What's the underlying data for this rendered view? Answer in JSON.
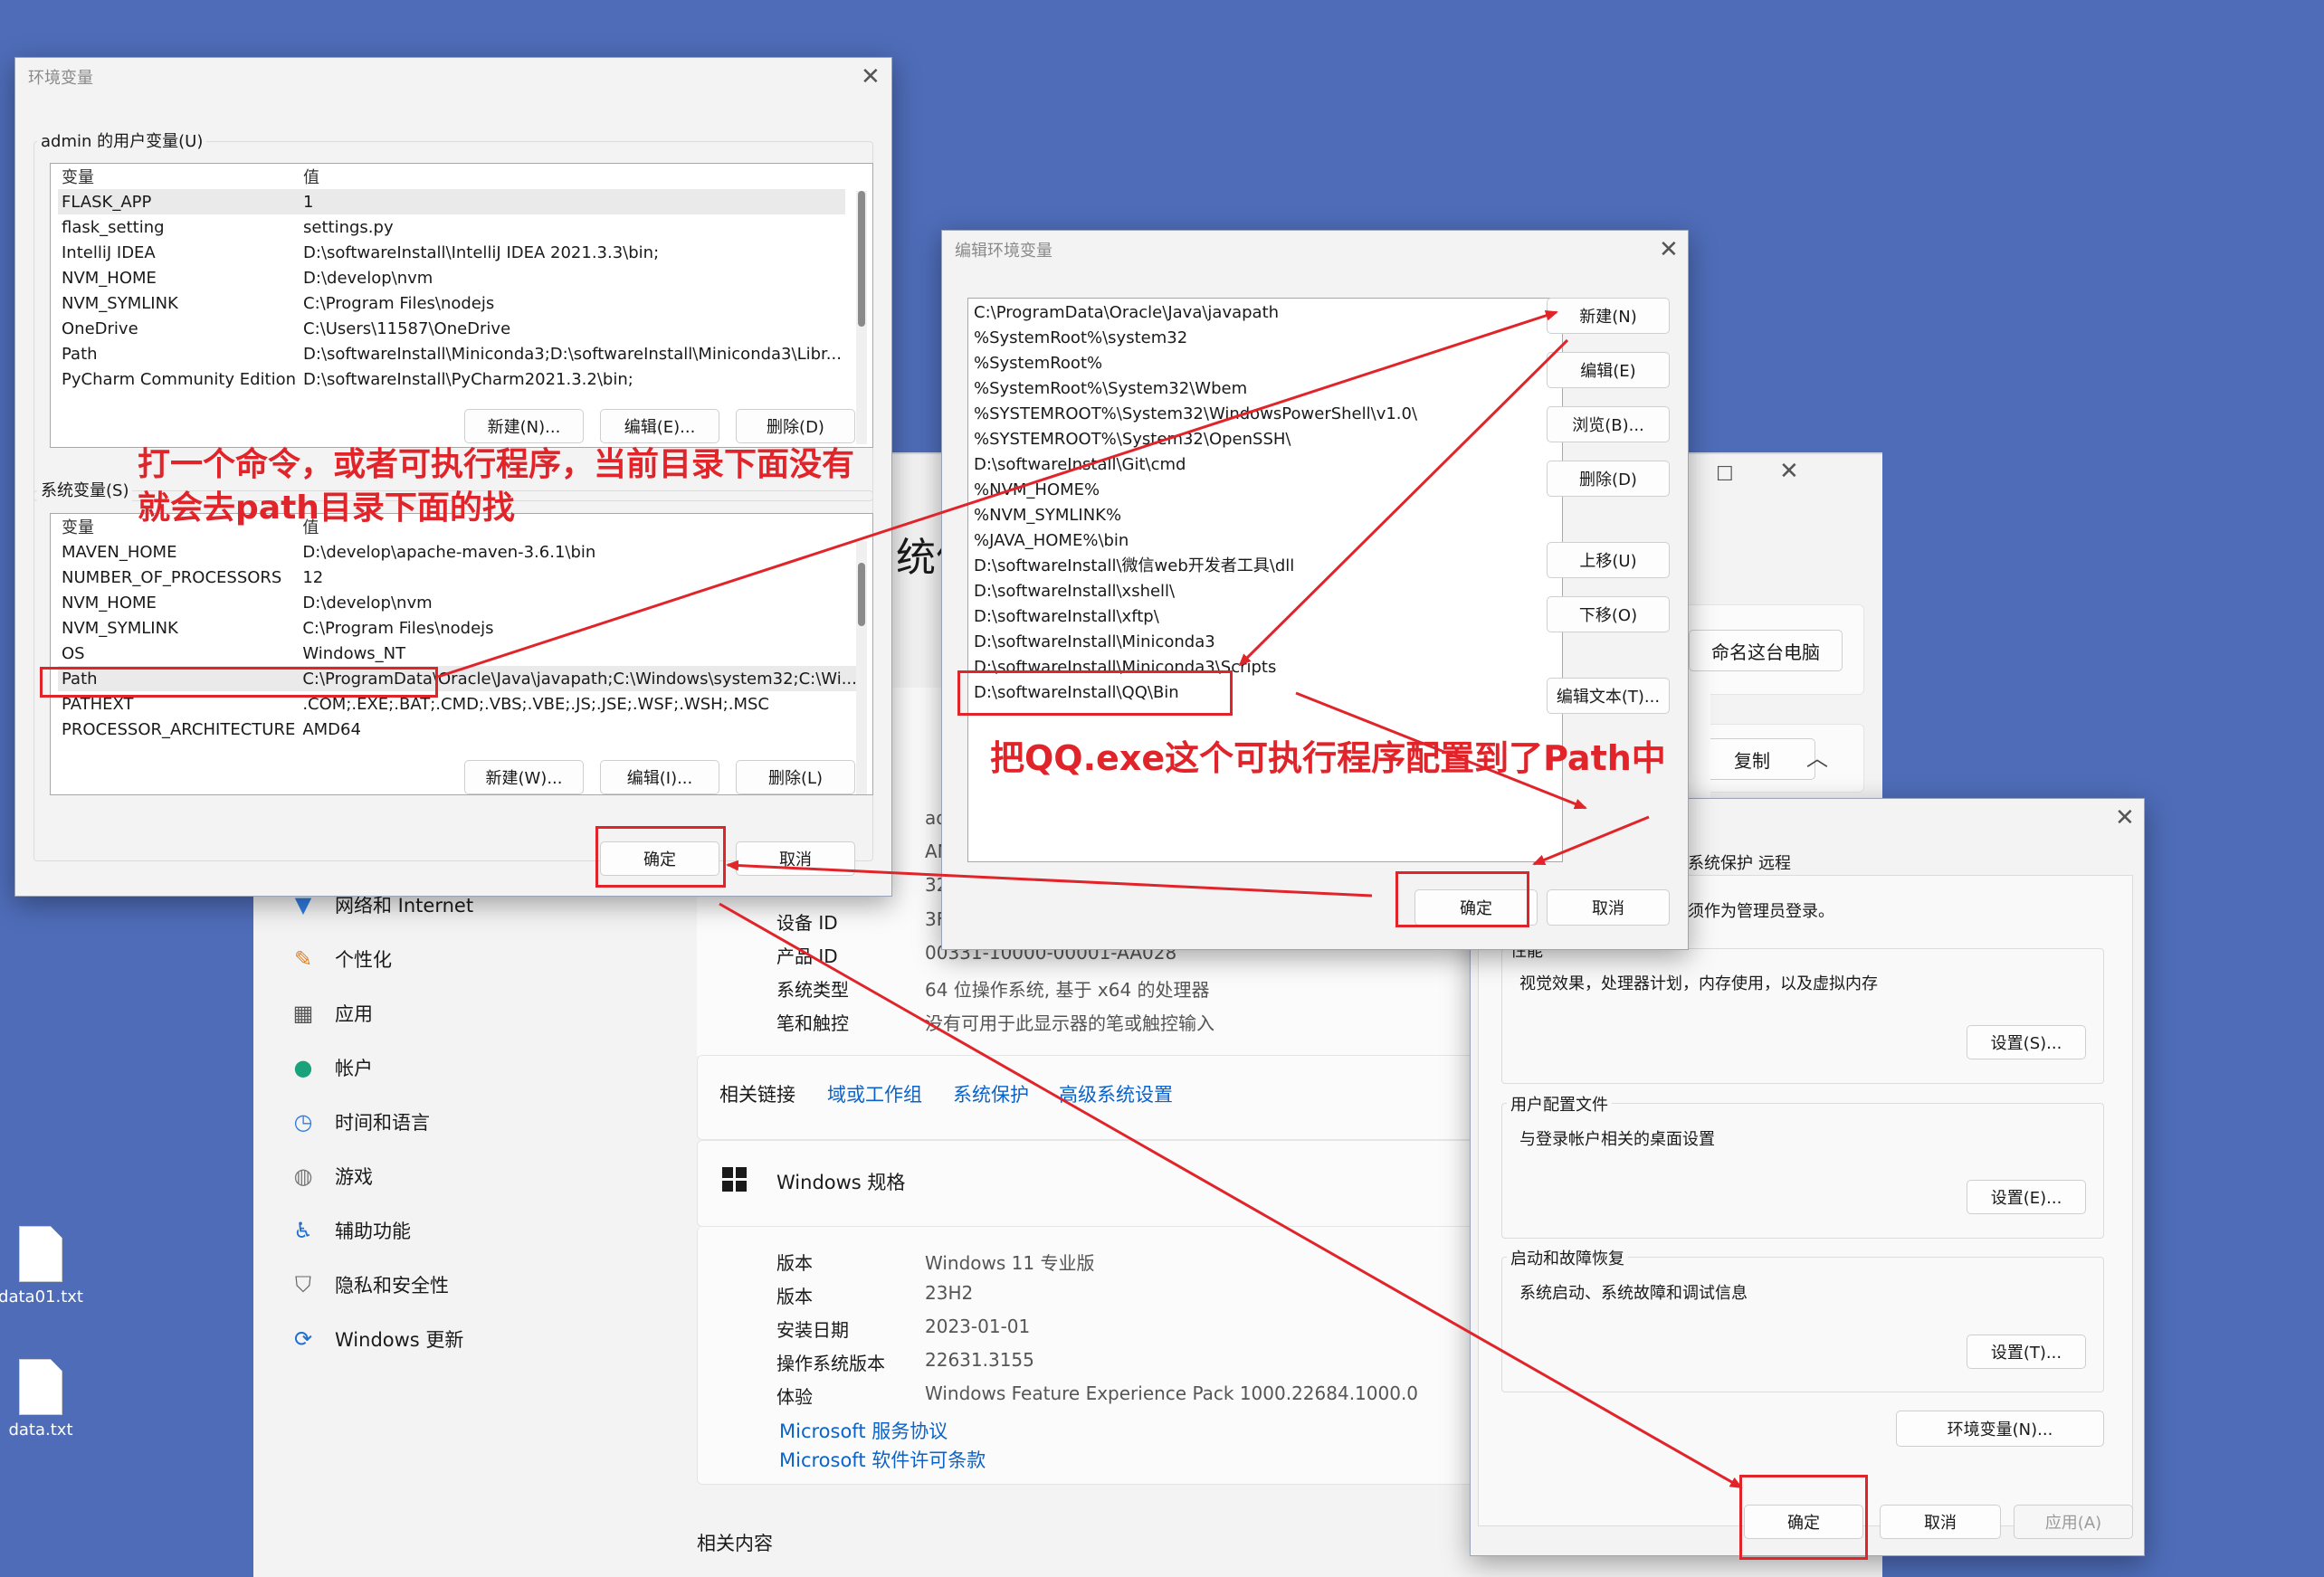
{
  "desktop": {
    "icons": [
      {
        "label": "data01.txt"
      },
      {
        "label": "data.txt"
      }
    ]
  },
  "settings": {
    "header_partial": "统信",
    "rename_button": "命名这台电脑",
    "copy_button": "复制",
    "nav": [
      {
        "label": "网络和 Internet",
        "icon": "wifi-icon"
      },
      {
        "label": "个性化",
        "icon": "brush-icon"
      },
      {
        "label": "应用",
        "icon": "apps-icon"
      },
      {
        "label": "帐户",
        "icon": "account-icon"
      },
      {
        "label": "时间和语言",
        "icon": "clock-globe-icon"
      },
      {
        "label": "游戏",
        "icon": "gamepad-icon"
      },
      {
        "label": "辅助功能",
        "icon": "accessibility-icon"
      },
      {
        "label": "隐私和安全性",
        "icon": "shield-icon"
      },
      {
        "label": "Windows 更新",
        "icon": "update-icon"
      }
    ],
    "device_specs_partial": [
      {
        "key": "",
        "value": "ad"
      },
      {
        "key": "",
        "value": "AN"
      },
      {
        "key": "",
        "value": "32"
      },
      {
        "key": "设备 ID",
        "value": "3F"
      },
      {
        "key": "产品 ID",
        "value": "00331-10000-00001-AA028"
      },
      {
        "key": "系统类型",
        "value": "64 位操作系统, 基于 x64 的处理器"
      },
      {
        "key": "笔和触控",
        "value": "没有可用于此显示器的笔或触控输入"
      }
    ],
    "related_links": {
      "label": "相关链接",
      "links": [
        "域或工作组",
        "系统保护",
        "高级系统设置"
      ]
    },
    "windows_spec": {
      "title": "Windows 规格",
      "rows": [
        {
          "key": "版本",
          "value": "Windows 11 专业版"
        },
        {
          "key": "版本",
          "value": "23H2"
        },
        {
          "key": "安装日期",
          "value": "2023-01-01"
        },
        {
          "key": "操作系统版本",
          "value": "22631.3155"
        },
        {
          "key": "体验",
          "value": "Windows Feature Experience Pack 1000.22684.1000.0"
        }
      ],
      "links": [
        "Microsoft 服务协议",
        "Microsoft 软件许可条款"
      ]
    },
    "related_content": "相关内容"
  },
  "sysprops": {
    "tabs": [
      "系统保护",
      "远程"
    ],
    "admin_note": "须作为管理员登录。",
    "performance": {
      "label": "性能",
      "desc": "视觉效果，处理器计划，内存使用，以及虚拟内存",
      "button": "设置(S)..."
    },
    "profile": {
      "label": "用户配置文件",
      "desc": "与登录帐户相关的桌面设置",
      "button": "设置(E)..."
    },
    "startup": {
      "label": "启动和故障恢复",
      "desc": "系统启动、系统故障和调试信息",
      "button": "设置(T)..."
    },
    "env_button": "环境变量(N)...",
    "ok": "确定",
    "cancel": "取消",
    "apply": "应用(A)"
  },
  "envvars": {
    "title": "环境变量",
    "user_group": "admin 的用户变量(U)",
    "col_var": "变量",
    "col_val": "值",
    "user_vars": [
      {
        "name": "FLASK_APP",
        "value": "1"
      },
      {
        "name": "flask_setting",
        "value": "settings.py"
      },
      {
        "name": "IntelliJ IDEA",
        "value": "D:\\softwareInstall\\IntelliJ IDEA 2021.3.3\\bin;"
      },
      {
        "name": "NVM_HOME",
        "value": "D:\\develop\\nvm"
      },
      {
        "name": "NVM_SYMLINK",
        "value": "C:\\Program Files\\nodejs"
      },
      {
        "name": "OneDrive",
        "value": "C:\\Users\\11587\\OneDrive"
      },
      {
        "name": "Path",
        "value": "D:\\softwareInstall\\Miniconda3;D:\\softwareInstall\\Miniconda3\\Libr..."
      },
      {
        "name": "PyCharm Community Edition",
        "value": "D:\\softwareInstall\\PyCharm2021.3.2\\bin;"
      }
    ],
    "user_buttons": [
      "新建(N)...",
      "编辑(E)...",
      "删除(D)"
    ],
    "system_group": "系统变量(S)",
    "system_vars": [
      {
        "name": "MAVEN_HOME",
        "value": "D:\\develop\\apache-maven-3.6.1\\bin"
      },
      {
        "name": "NUMBER_OF_PROCESSORS",
        "value": "12"
      },
      {
        "name": "NVM_HOME",
        "value": "D:\\develop\\nvm"
      },
      {
        "name": "NVM_SYMLINK",
        "value": "C:\\Program Files\\nodejs"
      },
      {
        "name": "OS",
        "value": "Windows_NT"
      },
      {
        "name": "Path",
        "value": "C:\\ProgramData\\Oracle\\Java\\javapath;C:\\Windows\\system32;C:\\Wi..."
      },
      {
        "name": "PATHEXT",
        "value": ".COM;.EXE;.BAT;.CMD;.VBS;.VBE;.JS;.JSE;.WSF;.WSH;.MSC"
      },
      {
        "name": "PROCESSOR_ARCHITECTURE",
        "value": "AMD64"
      }
    ],
    "system_buttons": [
      "新建(W)...",
      "编辑(I)...",
      "删除(L)"
    ],
    "ok": "确定",
    "cancel": "取消"
  },
  "editenv": {
    "title": "编辑环境变量",
    "entries": [
      "C:\\ProgramData\\Oracle\\Java\\javapath",
      "%SystemRoot%\\system32",
      "%SystemRoot%",
      "%SystemRoot%\\System32\\Wbem",
      "%SYSTEMROOT%\\System32\\WindowsPowerShell\\v1.0\\",
      "%SYSTEMROOT%\\System32\\OpenSSH\\",
      "D:\\softwareInstall\\Git\\cmd",
      "%NVM_HOME%",
      "%NVM_SYMLINK%",
      "%JAVA_HOME%\\bin",
      "D:\\softwareInstall\\微信web开发者工具\\dll",
      "D:\\softwareInstall\\xshell\\",
      "D:\\softwareInstall\\xftp\\",
      "D:\\softwareInstall\\Miniconda3",
      "D:\\softwareInstall\\Miniconda3\\Scripts",
      "D:\\softwareInstall\\QQ\\Bin"
    ],
    "buttons": [
      "新建(N)",
      "编辑(E)",
      "浏览(B)...",
      "删除(D)",
      "上移(U)",
      "下移(O)",
      "编辑文本(T)..."
    ],
    "ok": "确定",
    "cancel": "取消"
  },
  "annotations": {
    "text1_line1": "打一个命令，或者可执行程序，当前目录下面没有",
    "text1_line2": "就会去path目录下面的找",
    "text2": "把QQ.exe这个可执行程序配置到了Path中",
    "color": "#e0242a"
  }
}
